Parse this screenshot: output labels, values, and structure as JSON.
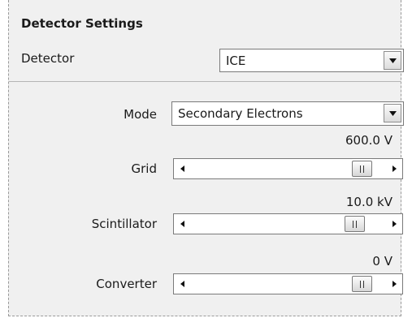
{
  "panel": {
    "title": "Detector Settings"
  },
  "detector": {
    "label": "Detector",
    "value": "ICE"
  },
  "mode": {
    "label": "Mode",
    "value": "Secondary Electrons"
  },
  "sliders": [
    {
      "label": "Grid",
      "value": "600.0 V",
      "position": 0.93
    },
    {
      "label": "Scintillator",
      "value": "10.0 kV",
      "position": 0.89
    },
    {
      "label": "Converter",
      "value": "0 V",
      "position": 0.93
    }
  ],
  "icons": {
    "dropdown": "triangle-down-icon",
    "slider_left": "triangle-left-icon",
    "slider_right": "triangle-right-icon",
    "thumb": "grip-icon"
  }
}
